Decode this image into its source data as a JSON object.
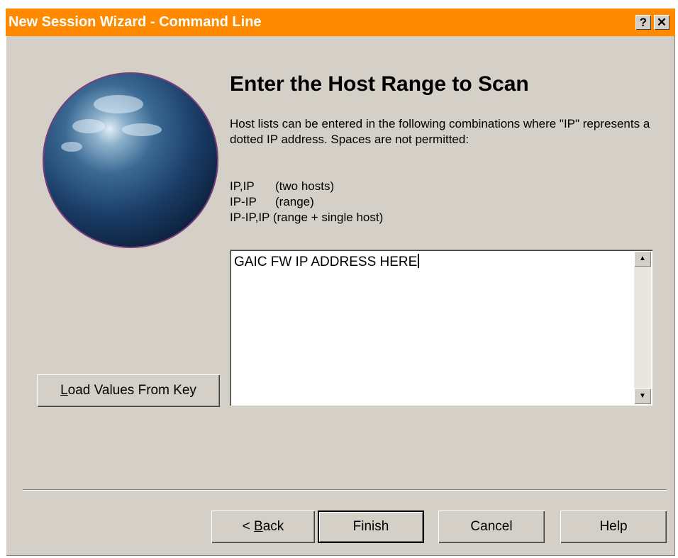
{
  "window": {
    "title": "New Session Wizard - Command Line",
    "help_button": "?",
    "close_button": "✕"
  },
  "content": {
    "heading": "Enter the Host Range to Scan",
    "description": "Host lists can be entered in the following combinations where \"IP\" represents a dotted IP address.  Spaces are not permitted:",
    "examples": [
      {
        "code": "IP,IP",
        "label": "(two hosts)"
      },
      {
        "code": "IP-IP",
        "label": "(range)"
      },
      {
        "code": "IP-IP,IP",
        "label": "(range + single host)"
      }
    ],
    "host_input_value": "GAIC FW IP ADDRESS HERE"
  },
  "buttons": {
    "load_values": {
      "mnemonic": "L",
      "rest": "oad Values From Key"
    },
    "back": {
      "prefix": "< ",
      "mnemonic": "B",
      "rest": "ack"
    },
    "finish": "Finish",
    "cancel": "Cancel",
    "help": "Help"
  },
  "colors": {
    "titlebar": "#ff8a00",
    "dialog_bg": "#d4d0c8"
  },
  "icons": {
    "globe": "globe-image",
    "scroll_up": "scroll-up-arrow-icon",
    "scroll_down": "scroll-down-arrow-icon"
  }
}
